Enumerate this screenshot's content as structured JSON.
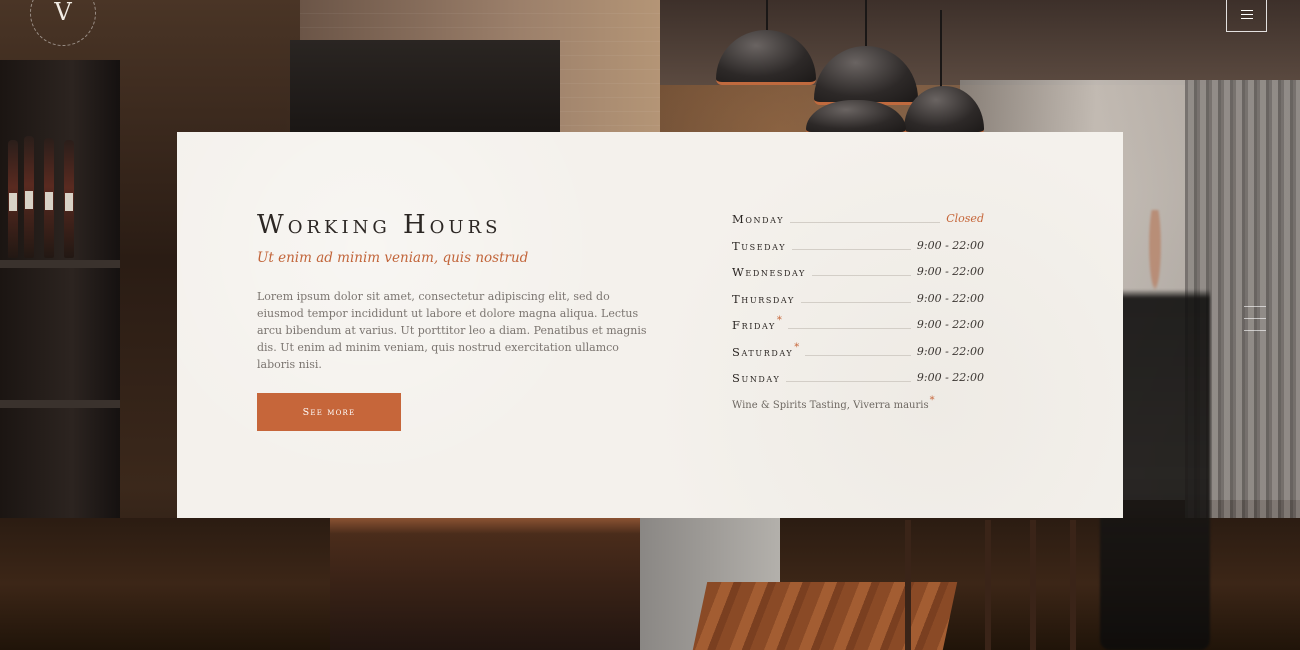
{
  "logo": {
    "mark": "V"
  },
  "menu": {
    "icon": "hamburger-icon"
  },
  "section": {
    "title": "Working Hours",
    "subtitle": "Ut enim ad minim veniam, quis nostrud",
    "body": "Lorem ipsum dolor sit amet, consectetur adipiscing elit, sed do eiusmod tempor incididunt ut labore et dolore magna aliqua. Lectus arcu bibendum at varius. Ut porttitor leo a diam. Penatibus et magnis dis. Ut enim ad minim veniam, quis nostrud exercitation ullamco laboris nisi.",
    "button_label": "See more"
  },
  "hours": [
    {
      "day": "Monday",
      "time": "Closed",
      "star": false,
      "closed": true
    },
    {
      "day": "Tuseday",
      "time": "9:00 - 22:00",
      "star": false,
      "closed": false
    },
    {
      "day": "Wednesday",
      "time": "9:00 - 22:00",
      "star": false,
      "closed": false
    },
    {
      "day": "Thursday",
      "time": "9:00 - 22:00",
      "star": false,
      "closed": false
    },
    {
      "day": "Friday",
      "time": "9:00 - 22:00",
      "star": true,
      "closed": false
    },
    {
      "day": "Saturday",
      "time": "9:00 - 22:00",
      "star": true,
      "closed": false
    },
    {
      "day": "Sunday",
      "time": "9:00 - 22:00",
      "star": false,
      "closed": false
    }
  ],
  "note": {
    "text": "Wine & Spirits Tasting, Viverra mauris",
    "star": "*"
  },
  "colors": {
    "accent": "#c6663a",
    "card_bg": "#f4f1ec",
    "heading": "#2c2724",
    "body_text": "#7b7570"
  }
}
